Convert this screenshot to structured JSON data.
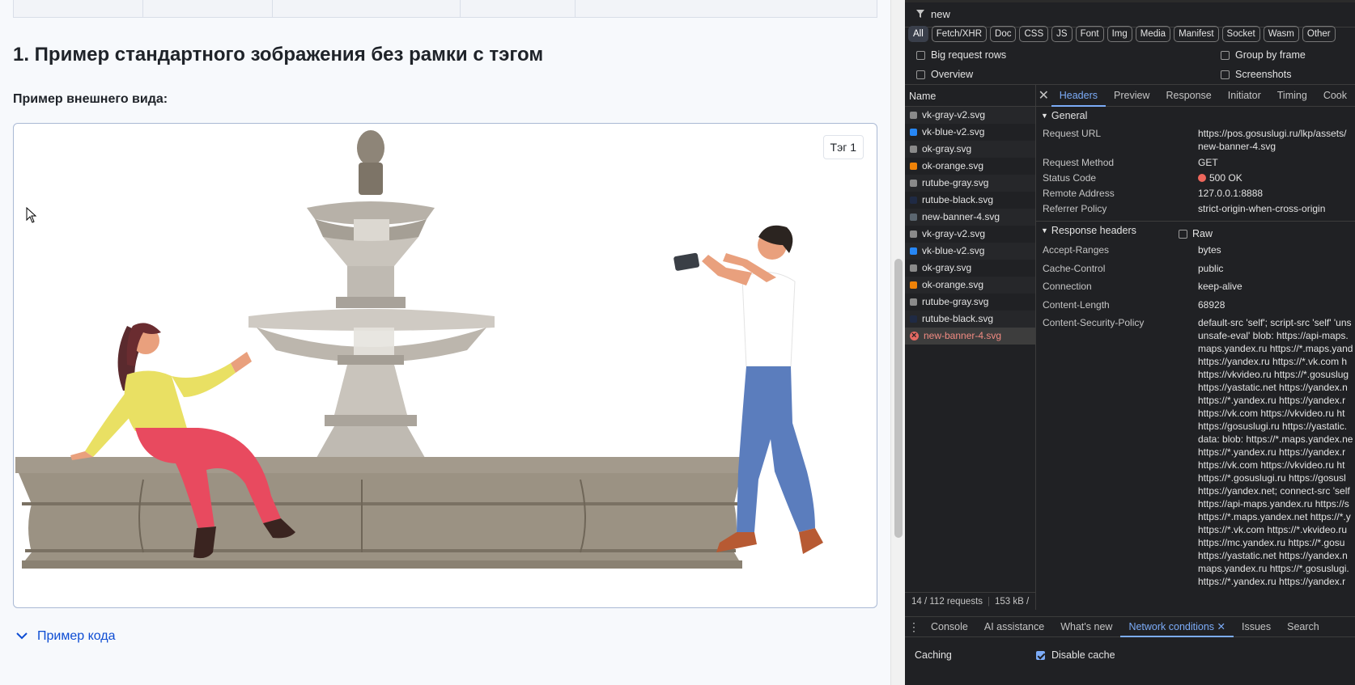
{
  "page": {
    "heading": "1. Пример стандартного зображения без рамки с тэгом",
    "subheading": "Пример внешнего вида:",
    "tag_label": "Тэг 1",
    "code_toggle_label": "Пример кода"
  },
  "devtools": {
    "filter_value": "new",
    "type_filters": [
      "All",
      "Fetch/XHR",
      "Doc",
      "CSS",
      "JS",
      "Font",
      "Img",
      "Media",
      "Manifest",
      "Socket",
      "Wasm",
      "Other"
    ],
    "active_type_filter": "All",
    "options": {
      "big_request_rows": "Big request rows",
      "group_by_frame": "Group by frame",
      "overview": "Overview",
      "screenshots": "Screenshots"
    },
    "name_header": "Name",
    "requests": [
      {
        "name": "vk-gray-v2.svg",
        "icon_color": "#8a8a8a"
      },
      {
        "name": "vk-blue-v2.svg",
        "icon_color": "#2787f5"
      },
      {
        "name": "ok-gray.svg",
        "icon_color": "#8a8a8a"
      },
      {
        "name": "ok-orange.svg",
        "icon_color": "#ee8208"
      },
      {
        "name": "rutube-gray.svg",
        "icon_color": "#8a8a8a"
      },
      {
        "name": "rutube-black.svg",
        "icon_color": "#1f2a44"
      },
      {
        "name": "new-banner-4.svg",
        "icon_color": "#5b6670"
      },
      {
        "name": "vk-gray-v2.svg",
        "icon_color": "#8a8a8a"
      },
      {
        "name": "vk-blue-v2.svg",
        "icon_color": "#2787f5"
      },
      {
        "name": "ok-gray.svg",
        "icon_color": "#8a8a8a"
      },
      {
        "name": "ok-orange.svg",
        "icon_color": "#ee8208"
      },
      {
        "name": "rutube-gray.svg",
        "icon_color": "#8a8a8a"
      },
      {
        "name": "rutube-black.svg",
        "icon_color": "#1f2a44"
      },
      {
        "name": "new-banner-4.svg",
        "icon_color": "error"
      }
    ],
    "footer": {
      "requests": "14 / 112 requests",
      "transferred": "153 kB /"
    },
    "detail_tabs": [
      "Headers",
      "Preview",
      "Response",
      "Initiator",
      "Timing",
      "Cook"
    ],
    "active_detail_tab": "Headers",
    "general": {
      "title": "General",
      "request_url_key": "Request URL",
      "request_url_value": "https://pos.gosuslugi.ru/lkp/assets/",
      "request_url_value_2": "new-banner-4.svg",
      "request_method_key": "Request Method",
      "request_method_value": "GET",
      "status_code_key": "Status Code",
      "status_code_value": "500 OK",
      "remote_address_key": "Remote Address",
      "remote_address_value": "127.0.0.1:8888",
      "referrer_policy_key": "Referrer Policy",
      "referrer_policy_value": "strict-origin-when-cross-origin"
    },
    "response_headers": {
      "title": "Response headers",
      "raw_label": "Raw",
      "accept_ranges_key": "Accept-Ranges",
      "accept_ranges_value": "bytes",
      "cache_control_key": "Cache-Control",
      "cache_control_value": "public",
      "connection_key": "Connection",
      "connection_value": "keep-alive",
      "content_length_key": "Content-Length",
      "content_length_value": "68928",
      "csp_key": "Content-Security-Policy",
      "csp_lines": [
        "default-src 'self'; script-src 'self' 'uns",
        "unsafe-eval' blob: https://api-maps.",
        "maps.yandex.ru https://*.maps.yand",
        "https://yandex.ru https://*.vk.com h",
        "https://vkvideo.ru https://*.gosuslug",
        "https://yastatic.net https://yandex.n",
        "https://*.yandex.ru https://yandex.r",
        "https://vk.com https://vkvideo.ru ht",
        "https://gosuslugi.ru https://yastatic.",
        "data: blob: https://*.maps.yandex.ne",
        "https://*.yandex.ru https://yandex.r",
        "https://vk.com https://vkvideo.ru ht",
        "https://*.gosuslugi.ru https://gosusl",
        "https://yandex.net; connect-src 'self",
        "https://api-maps.yandex.ru https://s",
        "https://*.maps.yandex.net https://*.y",
        "https://*.vk.com https://*.vkvideo.ru",
        "https://mc.yandex.ru https://*.gosu",
        "https://yastatic.net https://yandex.n",
        "maps.yandex.ru https://*.gosuslugi.",
        "https://*.yandex.ru https://yandex.r"
      ]
    },
    "drawer_tabs": [
      "Console",
      "AI assistance",
      "What's new",
      "Network conditions",
      "Issues",
      "Search"
    ],
    "active_drawer_tab": "Network conditions",
    "caching_label": "Caching",
    "disable_cache_label": "Disable cache"
  }
}
